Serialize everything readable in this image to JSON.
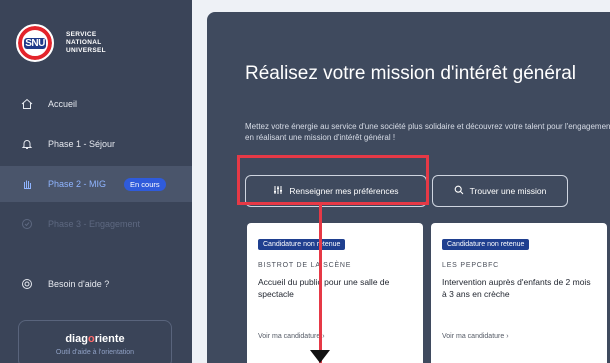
{
  "sidebar": {
    "logo": {
      "badge_text": "SNU",
      "line1": "SERVICE",
      "line2": "NATIONAL",
      "line3": "UNIVERSEL"
    },
    "items": [
      {
        "label": "Accueil",
        "icon": "home-icon"
      },
      {
        "label": "Phase 1 - Séjour",
        "icon": "bell-icon"
      },
      {
        "label": "Phase 2 - MIG",
        "icon": "hand-icon",
        "badge": "En cours"
      },
      {
        "label": "Phase 3 - Engagement",
        "icon": "check-circle-icon"
      },
      {
        "label": "Besoin d'aide ?",
        "icon": "lifebuoy-icon"
      }
    ],
    "diag": {
      "title_a": "diag",
      "title_o": "o",
      "title_b": "riente",
      "subtitle": "Outil d'aide à l'orientation"
    }
  },
  "hero": {
    "title": "Réalisez votre mission d'intérêt général",
    "description": "Mettez votre énergie au service d'une société plus solidaire et découvrez votre talent pour l'engagement en réalisant une mission d'intérêt général !",
    "btn_preferences": "Renseigner mes préférences",
    "btn_find": "Trouver une mission"
  },
  "cards": [
    {
      "badge": "Candidature non retenue",
      "org": "BISTROT DE LA SCÈNE",
      "title": "Accueil du public pour une salle de spectacle",
      "link": "Voir ma candidature ›"
    },
    {
      "badge": "Candidature non retenue",
      "org": "LES PEPCBFC",
      "title": "Intervention auprès d'enfants de 2 mois à 3 ans en crèche",
      "link": "Voir ma candidature ›"
    }
  ],
  "colors": {
    "sidebar": "#3a4458",
    "hero": "#3f4a5e",
    "accent": "#2f5bdb",
    "highlight": "#e63946",
    "badge": "#1f3f8f"
  }
}
